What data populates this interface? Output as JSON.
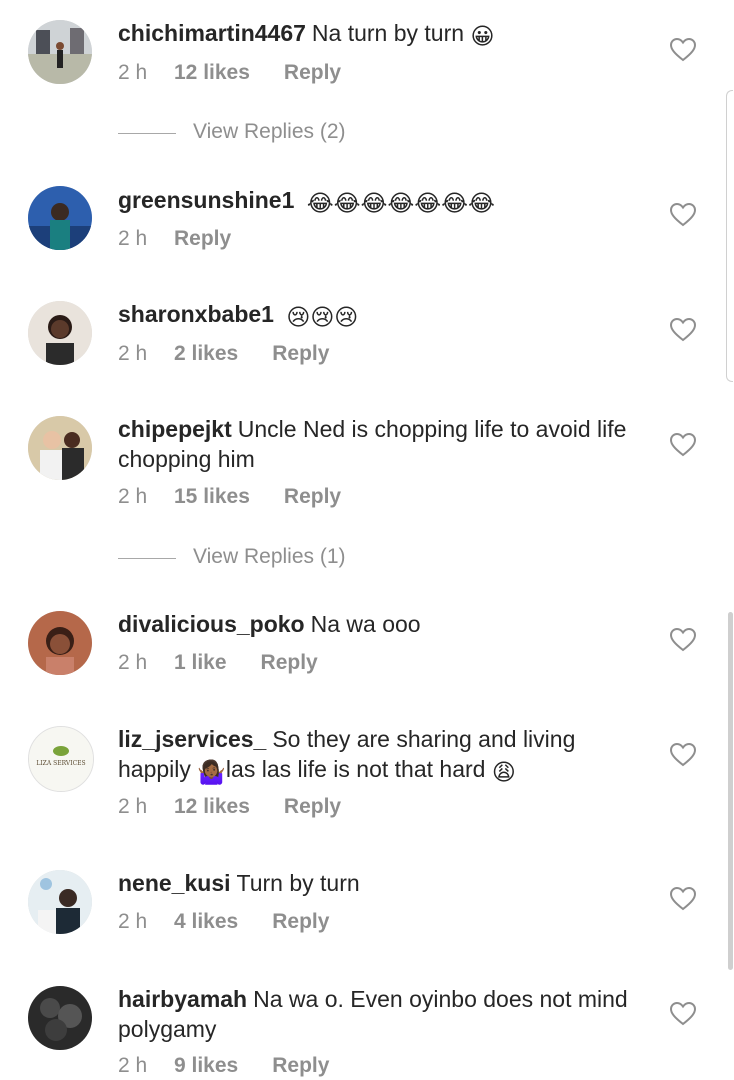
{
  "comments": [
    {
      "username": "chichimartin4467",
      "text": "Na turn by turn",
      "emoji": "😀",
      "time": "2 h",
      "likes": "12 likes",
      "reply": "Reply",
      "view_replies": "View Replies (2)"
    },
    {
      "username": "greensunshine1",
      "text": "",
      "emoji": "😂😂😂😂😂😂😂",
      "time": "2 h",
      "likes": "",
      "reply": "Reply"
    },
    {
      "username": "sharonxbabe1",
      "text": "",
      "emoji": "😢😢😢",
      "time": "2 h",
      "likes": "2 likes",
      "reply": "Reply"
    },
    {
      "username": "chipepejkt",
      "text": "Uncle Ned is chopping life to avoid life chopping him",
      "time": "2 h",
      "likes": "15 likes",
      "reply": "Reply",
      "view_replies": "View Replies (1)"
    },
    {
      "username": "divalicious_poko",
      "text": "Na wa ooo",
      "time": "2 h",
      "likes": "1 like",
      "reply": "Reply"
    },
    {
      "username": "liz_jservices_",
      "text": "So they are sharing and living happily",
      "emoji_mid": "🤷🏾‍♀️",
      "text2": "las las life is not that hard",
      "emoji": "😩",
      "time": "2 h",
      "likes": "12 likes",
      "reply": "Reply",
      "avatar_text": "LIZA SERVICES"
    },
    {
      "username": "nene_kusi",
      "text": "Turn by turn",
      "time": "2 h",
      "likes": "4 likes",
      "reply": "Reply"
    },
    {
      "username": "hairbyamah",
      "text": "Na wa o. Even oyinbo does not mind polygamy",
      "time": "2 h",
      "likes": "9 likes",
      "reply": "Reply"
    }
  ],
  "icons": {
    "like": "heart-outline-icon"
  },
  "colors": {
    "text": "#262626",
    "meta": "#8e8e8e",
    "background": "#ffffff"
  }
}
